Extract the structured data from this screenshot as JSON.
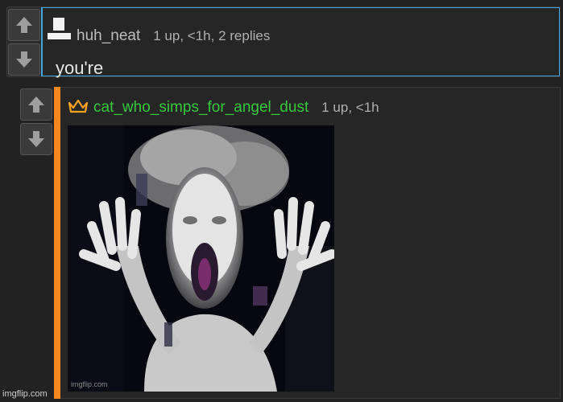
{
  "comments": [
    {
      "username": "huh_neat",
      "meta": "1 up, <1h, 2 replies",
      "text": "you're",
      "avatar_icon": "default-avatar-icon"
    },
    {
      "username": "cat_who_simps_for_angel_dust",
      "meta": "1 up, <1h",
      "badge_icon": "crown-icon",
      "image_alt": "Pale ghostly screaming figure with raised clawed hands on a dark background",
      "image_watermark": "imgflip.com"
    }
  ],
  "watermark": "imgflip.com",
  "colors": {
    "background": "#222222",
    "reply_accent": "#f6871f",
    "selected_border": "#3fa7df",
    "username_green": "#35c93b"
  }
}
